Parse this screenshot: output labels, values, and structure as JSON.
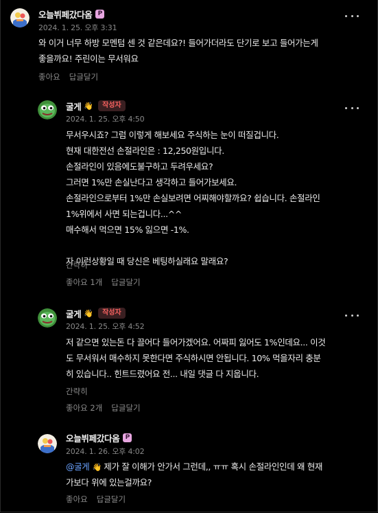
{
  "comments": [
    {
      "author": "오늘뷔페갔다옴",
      "badge": "P",
      "time": "2024. 1. 25. 오후 3:31",
      "lines": [
        "와 이거 너무 하방 모멘텀 센 것 같은데요?! 들어가더라도 단기로 보고 들어가는게",
        "좋을까요! 주린이는 무서워요"
      ],
      "like": "좋아요",
      "reply": "답글달기"
    },
    {
      "author": "굴게",
      "hand": "👋",
      "author_badge": "작성자",
      "time": "2024. 1. 25. 오후 4:50",
      "lines": [
        "무서우시죠? 그럼 이렇게 해보세요 주식하는 눈이 떠질겁니다.",
        "현재 대한전선 손절라인은 : 12,250원입니다.",
        "손절라인이 있음에도불구하고 두려우세요?",
        "그러면 1%만 손실난다고 생각하고 들어가보세요.",
        "손절라인으로부터 1%만 손실보려면 어찌해야할까요? 쉽습니다. 손절라인",
        "1%위에서 사면 되는겁니다...^^",
        "매수해서 먹으면 15% 잃으면 -1%.",
        "",
        "자 이런상황일 때 당신은 베팅하실래요 말래요?"
      ],
      "translate": "간략히",
      "like": "좋아요 1개",
      "reply": "답글달기"
    },
    {
      "author": "굴게",
      "hand": "👋",
      "author_badge": "작성자",
      "time": "2024. 1. 25. 오후 4:52",
      "lines": [
        "저 같으면 있는돈 다 끌어다 들어가겠어요. 어짜피 잃어도 1%인데요... 이것",
        "도 무서워서 매수하지 못한다면 주식하시면 안됩니다. 10% 먹을자리 충분",
        "히 있습니다.. 힌트드렸어요 전... 내일 댓글 다 지웁니다."
      ],
      "translate": "간략히",
      "like": "좋아요 2개",
      "reply": "답글달기"
    },
    {
      "author": "오늘뷔페갔다옴",
      "badge": "P",
      "time": "2024. 1. 26. 오후 4:02",
      "mention": "@굴게",
      "hand": "👋",
      "first_line_rest": " 제가 잘 이해가 안가서 그런데,, ㅠㅠ 혹시 손절라인인데 왜 현재",
      "lines": [
        "가보다 위에 있는걸까요?"
      ],
      "like": "좋아요",
      "reply": "답글달기"
    }
  ],
  "colors": {
    "background": "#000000",
    "mention": "#6aa2ff",
    "author_badge_text": "#f2605e",
    "badge_p": "#e7a6e0"
  },
  "icons": {
    "avatar_1": "cartoon-avatar",
    "avatar_2": "pepe-frog-avatar",
    "more": "more-horizontal-icon",
    "hand": "waving-hand-icon"
  }
}
